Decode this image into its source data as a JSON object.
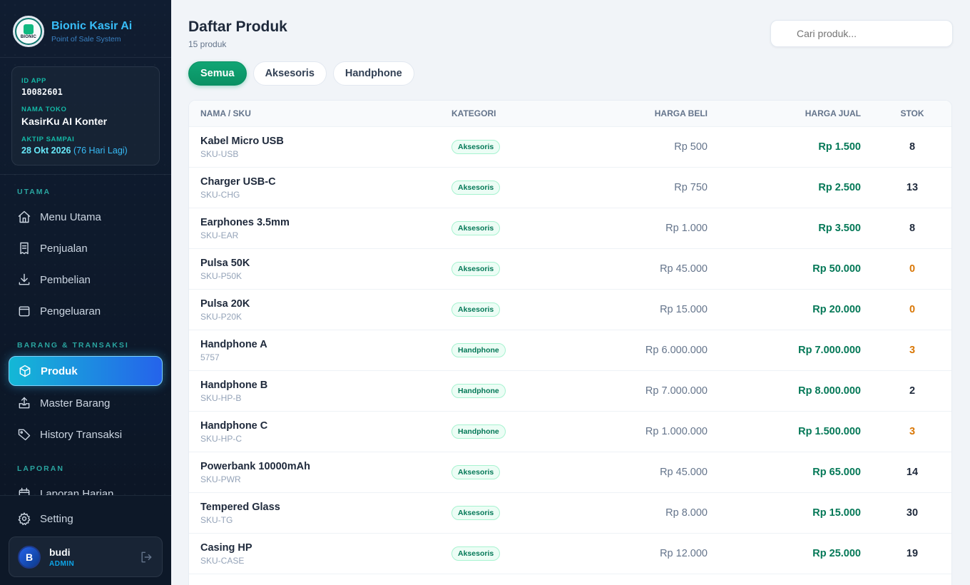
{
  "sidebar": {
    "brand_title": "Bionic Kasir Ai",
    "brand_sub": "Point of Sale System",
    "logo_text": "BIONIC",
    "id_app_label": "ID APP",
    "id_app": "10082601",
    "toko_label": "NAMA TOKO",
    "toko": "KasirKu AI Konter",
    "aktif_label": "AKTIP SAMPAI",
    "aktif_date": "28 Okt 2026",
    "aktif_remaining": "(76 Hari Lagi)",
    "sec_utama": "UTAMA",
    "sec_barang": "BARANG & TRANSAKSI",
    "sec_laporan": "LAPORAN",
    "nav": {
      "menu_utama": "Menu Utama",
      "penjualan": "Penjualan",
      "pembelian": "Pembelian",
      "pengeluaran": "Pengeluaran",
      "produk": "Produk",
      "master_barang": "Master Barang",
      "history": "History Transaksi",
      "laporan_harian": "Laporan Harian",
      "setting": "Setting"
    },
    "user": {
      "initial": "B",
      "name": "budi",
      "role": "ADMIN"
    }
  },
  "header": {
    "title": "Daftar Produk",
    "count": "15 produk",
    "search_placeholder": "Cari produk..."
  },
  "tabs": [
    "Semua",
    "Aksesoris",
    "Handphone"
  ],
  "table": {
    "headers": {
      "name": "NAMA / SKU",
      "category": "KATEGORI",
      "buy": "HARGA BELI",
      "sell": "HARGA JUAL",
      "stock": "STOK"
    },
    "rows": [
      {
        "name": "Kabel Micro USB",
        "sku": "SKU-USB",
        "category": "Aksesoris",
        "buy": "Rp 500",
        "sell": "Rp 1.500",
        "stock": "8",
        "low": false
      },
      {
        "name": "Charger USB-C",
        "sku": "SKU-CHG",
        "category": "Aksesoris",
        "buy": "Rp 750",
        "sell": "Rp 2.500",
        "stock": "13",
        "low": false
      },
      {
        "name": "Earphones 3.5mm",
        "sku": "SKU-EAR",
        "category": "Aksesoris",
        "buy": "Rp 1.000",
        "sell": "Rp 3.500",
        "stock": "8",
        "low": false
      },
      {
        "name": "Pulsa 50K",
        "sku": "SKU-P50K",
        "category": "Aksesoris",
        "buy": "Rp 45.000",
        "sell": "Rp 50.000",
        "stock": "0",
        "low": true
      },
      {
        "name": "Pulsa 20K",
        "sku": "SKU-P20K",
        "category": "Aksesoris",
        "buy": "Rp 15.000",
        "sell": "Rp 20.000",
        "stock": "0",
        "low": true
      },
      {
        "name": "Handphone A",
        "sku": "5757",
        "category": "Handphone",
        "buy": "Rp 6.000.000",
        "sell": "Rp 7.000.000",
        "stock": "3",
        "low": true
      },
      {
        "name": "Handphone B",
        "sku": "SKU-HP-B",
        "category": "Handphone",
        "buy": "Rp 7.000.000",
        "sell": "Rp 8.000.000",
        "stock": "2",
        "low": false
      },
      {
        "name": "Handphone C",
        "sku": "SKU-HP-C",
        "category": "Handphone",
        "buy": "Rp 1.000.000",
        "sell": "Rp 1.500.000",
        "stock": "3",
        "low": true
      },
      {
        "name": "Powerbank 10000mAh",
        "sku": "SKU-PWR",
        "category": "Aksesoris",
        "buy": "Rp 45.000",
        "sell": "Rp 65.000",
        "stock": "14",
        "low": false
      },
      {
        "name": "Tempered Glass",
        "sku": "SKU-TG",
        "category": "Aksesoris",
        "buy": "Rp 8.000",
        "sell": "Rp 15.000",
        "stock": "30",
        "low": false
      },
      {
        "name": "Casing HP",
        "sku": "SKU-CASE",
        "category": "Aksesoris",
        "buy": "Rp 12.000",
        "sell": "Rp 25.000",
        "stock": "19",
        "low": false
      }
    ]
  },
  "colors": {
    "accent_green": "#047857",
    "low_stock": "#d97706",
    "brand_blue": "#38bdf8"
  }
}
